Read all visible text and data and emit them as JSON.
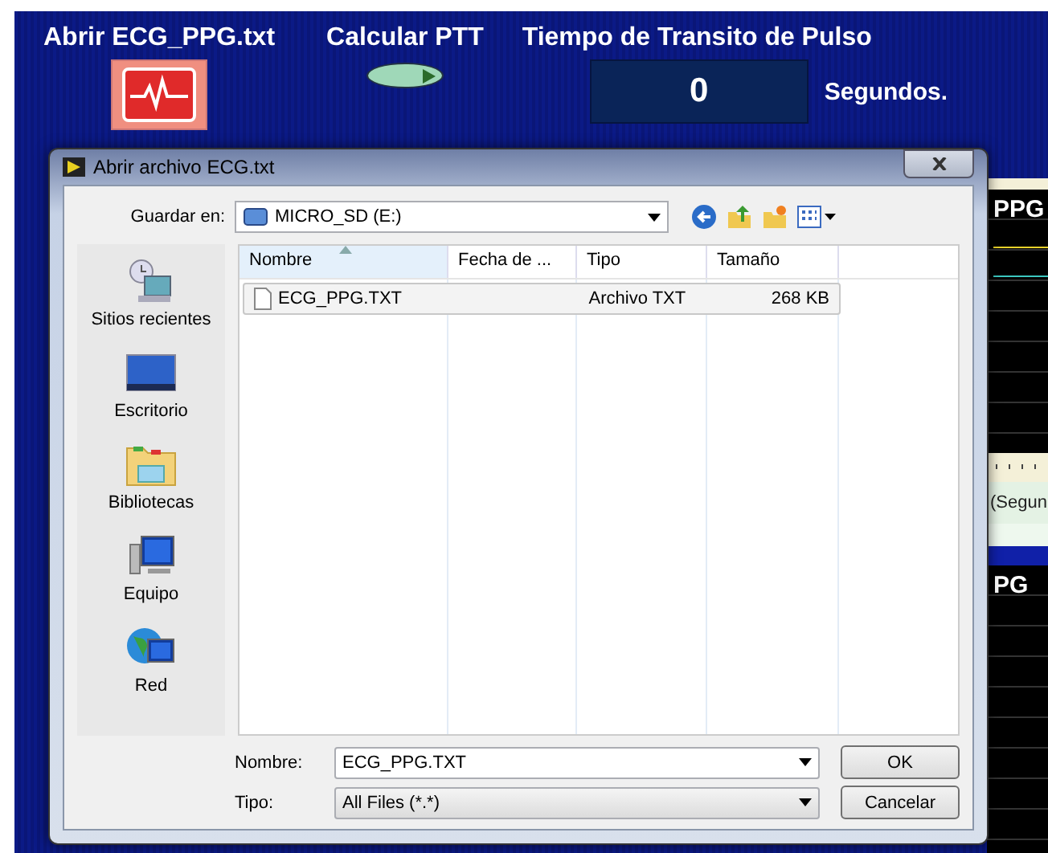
{
  "panel": {
    "open_control": {
      "label": "Abrir ECG_PPG.txt"
    },
    "calc_control": {
      "label": "Calcular PTT",
      "on": false
    },
    "ptt": {
      "label": "Tiempo de Transito de Pulso",
      "value": "0",
      "unit": "Segundos."
    },
    "graphs": [
      {
        "title": "PPG"
      },
      {
        "title": "PG"
      }
    ],
    "axis_label": "(Segun"
  },
  "dialog": {
    "title": "Abrir archivo ECG.txt",
    "location_label": "Guardar en:",
    "location": "MICRO_SD (E:)",
    "places": [
      {
        "label": "Sitios recientes",
        "kind": "recent"
      },
      {
        "label": "Escritorio",
        "kind": "desktop"
      },
      {
        "label": "Bibliotecas",
        "kind": "libraries"
      },
      {
        "label": "Equipo",
        "kind": "computer"
      },
      {
        "label": "Red",
        "kind": "network"
      }
    ],
    "columns": [
      {
        "label": "Nombre",
        "sorted": true
      },
      {
        "label": "Fecha de ...",
        "sorted": false
      },
      {
        "label": "Tipo",
        "sorted": false
      },
      {
        "label": "Tamaño",
        "sorted": false
      }
    ],
    "rows": [
      {
        "name": "ECG_PPG.TXT",
        "date": "",
        "type": "Archivo TXT",
        "size": "268 KB",
        "selected": true
      }
    ],
    "filename_label": "Nombre:",
    "filename": "ECG_PPG.TXT",
    "type_label": "Tipo:",
    "filetype": "All Files (*.*)",
    "buttons": [
      "OK",
      "Cancelar"
    ]
  }
}
